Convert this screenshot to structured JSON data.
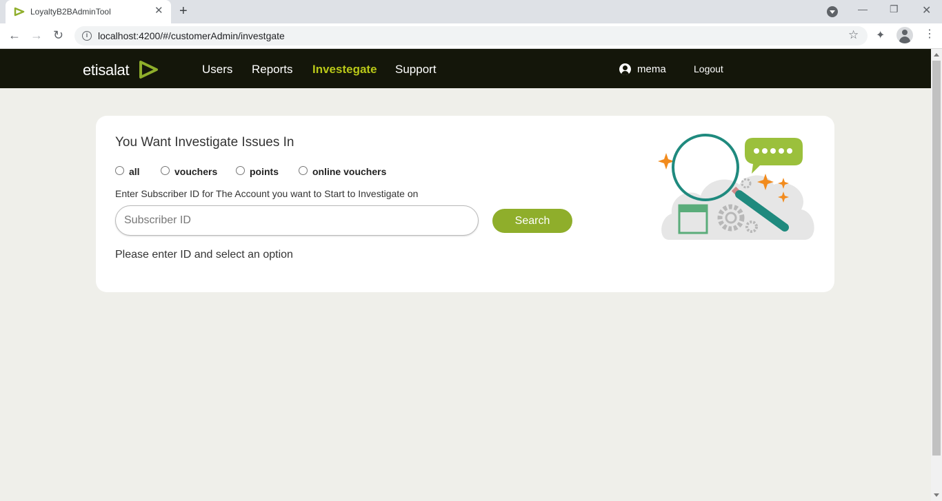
{
  "browser": {
    "tab_title": "LoyaltyB2BAdminTool",
    "url": "localhost:4200/#/customerAdmin/investgate",
    "tab_close_glyph": "✕",
    "new_tab_glyph": "+"
  },
  "header": {
    "logo_text": "etisalat",
    "nav": [
      {
        "label": "Users",
        "active": false
      },
      {
        "label": "Reports",
        "active": false
      },
      {
        "label": "Investegate",
        "active": true
      },
      {
        "label": "Support",
        "active": false
      }
    ],
    "username": "mema",
    "logout_label": "Logout"
  },
  "card": {
    "title": "You Want Investigate Issues In",
    "options": [
      {
        "label": "all",
        "checked": false
      },
      {
        "label": "vouchers",
        "checked": false
      },
      {
        "label": "points",
        "checked": false
      },
      {
        "label": "online vouchers",
        "checked": false
      }
    ],
    "prompt": "Enter Subscriber ID for The Account you want to Start to Investigate on",
    "input_placeholder": "Subscriber ID",
    "input_value": "",
    "search_label": "Search",
    "status_message": "Please enter ID and select an option"
  },
  "colors": {
    "header_bg": "#14160a",
    "active_nav": "#b9c818",
    "button": "#8fae2b",
    "page_bg": "#efefea"
  },
  "icons": {
    "favicon": "etisalat-logo-icon",
    "illustration": "magnifier-search-illustration"
  }
}
